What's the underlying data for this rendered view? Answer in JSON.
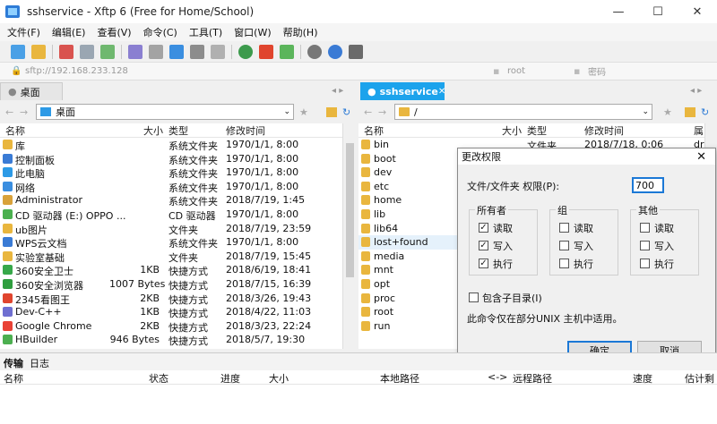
{
  "window": {
    "title": "sshservice   - Xftp 6 (Free for Home/School)",
    "minimize": "—",
    "maximize": "☐",
    "close": "✕"
  },
  "menu": [
    "文件(F)",
    "编辑(E)",
    "查看(V)",
    "命令(C)",
    "工具(T)",
    "窗口(W)",
    "帮助(H)"
  ],
  "address": {
    "host_placeholder": "sftp://192.168.233.128",
    "user_placeholder": "root",
    "password_placeholder": "密码"
  },
  "left_pane": {
    "tab_label": "桌面",
    "path": "桌面",
    "columns": {
      "name": "名称",
      "size": "大小",
      "type": "类型",
      "modified": "修改时间"
    },
    "rows": [
      {
        "name": "库",
        "size": "",
        "type": "系统文件夹",
        "modified": "1970/1/1, 8:00",
        "color": "#e9b63e"
      },
      {
        "name": "控制面板",
        "size": "",
        "type": "系统文件夹",
        "modified": "1970/1/1, 8:00",
        "color": "#3a7bd5"
      },
      {
        "name": "此电脑",
        "size": "",
        "type": "系统文件夹",
        "modified": "1970/1/1, 8:00",
        "color": "#2d9ae6"
      },
      {
        "name": "网络",
        "size": "",
        "type": "系统文件夹",
        "modified": "1970/1/1, 8:00",
        "color": "#3a8ee0"
      },
      {
        "name": "Administrator",
        "size": "",
        "type": "系统文件夹",
        "modified": "2018/7/19, 1:45",
        "color": "#d9a23a"
      },
      {
        "name": "CD 驱动器 (E:) OPPO ...",
        "size": "",
        "type": "CD 驱动器",
        "modified": "1970/1/1, 8:00",
        "color": "#4bb04f"
      },
      {
        "name": "ub图片",
        "size": "",
        "type": "文件夹",
        "modified": "2018/7/19, 23:59",
        "color": "#e9b63e"
      },
      {
        "name": "WPS云文档",
        "size": "",
        "type": "系统文件夹",
        "modified": "1970/1/1, 8:00",
        "color": "#3a7bd5"
      },
      {
        "name": "实验室基础",
        "size": "",
        "type": "文件夹",
        "modified": "2018/7/19, 15:45",
        "color": "#e9b63e"
      },
      {
        "name": "360安全卫士",
        "size": "1KB",
        "type": "快捷方式",
        "modified": "2018/6/19, 18:41",
        "color": "#37a84a"
      },
      {
        "name": "360安全浏览器",
        "size": "1007 Bytes",
        "type": "快捷方式",
        "modified": "2018/7/15, 16:39",
        "color": "#2f9e3f"
      },
      {
        "name": "2345看图王",
        "size": "2KB",
        "type": "快捷方式",
        "modified": "2018/3/26, 19:43",
        "color": "#e0452e"
      },
      {
        "name": "Dev-C++",
        "size": "1KB",
        "type": "快捷方式",
        "modified": "2018/4/22, 11:03",
        "color": "#6f6fd1"
      },
      {
        "name": "Google Chrome",
        "size": "2KB",
        "type": "快捷方式",
        "modified": "2018/3/23, 22:24",
        "color": "#e94235"
      },
      {
        "name": "HBuilder",
        "size": "946 Bytes",
        "type": "快捷方式",
        "modified": "2018/5/7, 19:30",
        "color": "#4caf50"
      }
    ]
  },
  "right_pane": {
    "tab_label": "sshservice",
    "path": "/",
    "columns": {
      "name": "名称",
      "size": "大小",
      "type": "类型",
      "modified": "修改时间",
      "attr": "属"
    },
    "first_row_type": "文件夹",
    "first_row_modified": "2018/7/18, 0:06",
    "first_row_attr": "dr",
    "rows": [
      {
        "name": "bin"
      },
      {
        "name": "boot"
      },
      {
        "name": "dev"
      },
      {
        "name": "etc"
      },
      {
        "name": "home"
      },
      {
        "name": "lib"
      },
      {
        "name": "lib64"
      },
      {
        "name": "lost+found"
      },
      {
        "name": "media"
      },
      {
        "name": "mnt"
      },
      {
        "name": "opt"
      },
      {
        "name": "proc"
      },
      {
        "name": "root"
      },
      {
        "name": "run"
      }
    ]
  },
  "dialog": {
    "title": "更改权限",
    "close": "✕",
    "perm_label": "文件/文件夹 权限(P):",
    "perm_value": "700",
    "groups": [
      {
        "title": "所有者",
        "read": "读取",
        "write": "写入",
        "exec": "执行",
        "checked": [
          true,
          true,
          true
        ]
      },
      {
        "title": "组",
        "read": "读取",
        "write": "写入",
        "exec": "执行",
        "checked": [
          false,
          false,
          false
        ]
      },
      {
        "title": "其他",
        "read": "读取",
        "write": "写入",
        "exec": "执行",
        "checked": [
          false,
          false,
          false
        ]
      }
    ],
    "recurse_label": "包含子目录(I)",
    "note": "此命令仅在部分UNIX 主机中适用。",
    "ok": "确定",
    "cancel": "取消"
  },
  "bottom": {
    "tabs": [
      "传输",
      "日志"
    ],
    "columns": [
      "名称",
      "状态",
      "进度",
      "大小",
      "本地路径",
      "<->",
      "远程路径",
      "速度",
      "估计剩"
    ]
  }
}
